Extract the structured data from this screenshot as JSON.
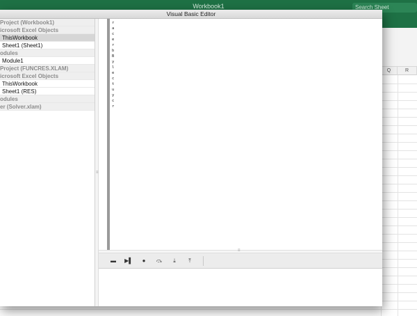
{
  "excel": {
    "workbook_title": "Workbook1",
    "search_placeholder": "Search Sheet",
    "columns": [
      "Q",
      "R"
    ]
  },
  "vbe": {
    "title": "Visual Basic Editor",
    "project_tree": [
      {
        "label": "Project (Workbook1)",
        "kind": "group"
      },
      {
        "label": "icrosoft Excel Objects",
        "kind": "group"
      },
      {
        "label": "ThisWorkbook",
        "kind": "item",
        "selected": true
      },
      {
        "label": "Sheet1 (Sheet1)",
        "kind": "item"
      },
      {
        "label": "odules",
        "kind": "group"
      },
      {
        "label": "Module1",
        "kind": "item"
      },
      {
        "label": "Project (FUNCRES.XLAM)",
        "kind": "group"
      },
      {
        "label": "icrosoft Excel Objects",
        "kind": "group"
      },
      {
        "label": "ThisWorkbook",
        "kind": "item"
      },
      {
        "label": "Sheet1 (RES)",
        "kind": "item"
      },
      {
        "label": "odules",
        "kind": "group"
      },
      {
        "label": "er (Solver.xlam)",
        "kind": "group"
      }
    ],
    "code_letters": [
      "r",
      "a",
      "c",
      "e",
      "r",
      "b",
      "B",
      "y",
      "l",
      "e",
      "c",
      "t",
      "u",
      "y",
      "c",
      "r"
    ],
    "debug_toolbar": [
      {
        "name": "run-icon",
        "glyph": "▬"
      },
      {
        "name": "step-icon",
        "glyph": "▶▌"
      },
      {
        "name": "stop-icon",
        "glyph": "●"
      },
      {
        "name": "step-over-icon",
        "glyph": "⤼"
      },
      {
        "name": "step-into-icon",
        "glyph": "⤓"
      },
      {
        "name": "step-out-icon",
        "glyph": "⤒"
      }
    ]
  }
}
